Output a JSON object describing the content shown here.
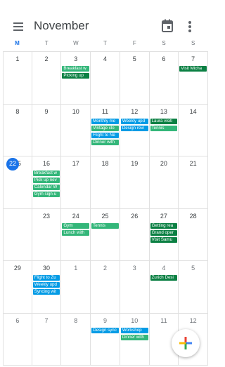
{
  "header": {
    "title": "November",
    "menu_icon": "hamburger-menu-icon",
    "today_icon": "calendar-today-icon",
    "more_icon": "more-vert-icon"
  },
  "weekdays": [
    "M",
    "T",
    "W",
    "T",
    "F",
    "S",
    "S"
  ],
  "weeks": [
    [
      {
        "day": "1",
        "muted": false,
        "events": []
      },
      {
        "day": "2",
        "muted": false,
        "events": []
      },
      {
        "day": "3",
        "muted": false,
        "events": [
          {
            "title": "Breakfast w",
            "color": "#33b679"
          },
          {
            "title": "Picking up",
            "color": "#0b8043"
          }
        ]
      },
      {
        "day": "4",
        "muted": false,
        "events": []
      },
      {
        "day": "5",
        "muted": false,
        "events": []
      },
      {
        "day": "6",
        "muted": false,
        "events": []
      },
      {
        "day": "7",
        "muted": false,
        "events": [
          {
            "title": "Visit Micha",
            "color": "#0b8043"
          }
        ]
      }
    ],
    [
      {
        "day": "8",
        "muted": false,
        "events": []
      },
      {
        "day": "9",
        "muted": false,
        "events": []
      },
      {
        "day": "10",
        "muted": false,
        "events": []
      },
      {
        "day": "11",
        "muted": false,
        "events": [
          {
            "title": "Monthly me",
            "color": "#039be5"
          },
          {
            "title": "Vintage clo",
            "color": "#33b679"
          },
          {
            "title": "Flight to Ne",
            "color": "#039be5"
          },
          {
            "title": "Dinner with",
            "color": "#33b679"
          }
        ]
      },
      {
        "day": "12",
        "muted": false,
        "events": [
          {
            "title": "Weekly upd",
            "color": "#039be5"
          },
          {
            "title": "Design revi",
            "color": "#039be5"
          }
        ]
      },
      {
        "day": "13",
        "muted": false,
        "events": [
          {
            "title": "Laura visiti",
            "color": "#0b8043"
          },
          {
            "title": "Tennis",
            "color": "#33b679"
          }
        ]
      },
      {
        "day": "14",
        "muted": false,
        "events": []
      }
    ],
    [
      {
        "day": "15",
        "muted": false,
        "events": []
      },
      {
        "day": "16",
        "muted": false,
        "events": [
          {
            "title": "Breakfast w",
            "color": "#33b679"
          },
          {
            "title": "Pick up nev",
            "color": "#33b679"
          },
          {
            "title": "Calendar W",
            "color": "#33b679"
          },
          {
            "title": "Gym sign-u",
            "color": "#33b679"
          }
        ]
      },
      {
        "day": "17",
        "muted": false,
        "events": []
      },
      {
        "day": "18",
        "muted": false,
        "events": []
      },
      {
        "day": "19",
        "muted": false,
        "events": []
      },
      {
        "day": "20",
        "muted": false,
        "events": []
      },
      {
        "day": "21",
        "muted": false,
        "events": []
      }
    ],
    [
      {
        "day": "22",
        "muted": false,
        "today": true,
        "events": []
      },
      {
        "day": "23",
        "muted": false,
        "events": []
      },
      {
        "day": "24",
        "muted": false,
        "events": [
          {
            "title": "Gym",
            "color": "#33b679"
          },
          {
            "title": "Lunch with",
            "color": "#33b679"
          }
        ]
      },
      {
        "day": "25",
        "muted": false,
        "events": [
          {
            "title": "Tennis",
            "color": "#33b679"
          }
        ]
      },
      {
        "day": "26",
        "muted": false,
        "events": []
      },
      {
        "day": "27",
        "muted": false,
        "events": [
          {
            "title": "Getting rea",
            "color": "#0b8043"
          },
          {
            "title": "Grand oper",
            "color": "#0b8043"
          },
          {
            "title": "Visit Samu",
            "color": "#0b8043"
          }
        ]
      },
      {
        "day": "28",
        "muted": false,
        "events": []
      }
    ],
    [
      {
        "day": "29",
        "muted": false,
        "events": []
      },
      {
        "day": "30",
        "muted": false,
        "events": [
          {
            "title": "Flight to Zu",
            "color": "#039be5"
          },
          {
            "title": "Weekly upd",
            "color": "#039be5"
          },
          {
            "title": "Syncing wit",
            "color": "#039be5"
          }
        ]
      },
      {
        "day": "1",
        "muted": true,
        "events": []
      },
      {
        "day": "2",
        "muted": true,
        "events": []
      },
      {
        "day": "3",
        "muted": true,
        "events": []
      },
      {
        "day": "4",
        "muted": true,
        "events": [
          {
            "title": "Zurich Desi",
            "color": "#0b8043"
          }
        ]
      },
      {
        "day": "5",
        "muted": true,
        "events": []
      }
    ],
    [
      {
        "day": "6",
        "muted": true,
        "events": []
      },
      {
        "day": "7",
        "muted": true,
        "events": []
      },
      {
        "day": "8",
        "muted": true,
        "events": []
      },
      {
        "day": "9",
        "muted": true,
        "events": [
          {
            "title": "Design sync",
            "color": "#039be5"
          }
        ]
      },
      {
        "day": "10",
        "muted": true,
        "events": [
          {
            "title": "Workshop",
            "color": "#039be5"
          },
          {
            "title": "Dinner with",
            "color": "#33b679"
          }
        ]
      },
      {
        "day": "11",
        "muted": true,
        "events": []
      },
      {
        "day": "12",
        "muted": true,
        "events": []
      }
    ]
  ],
  "fab": {
    "icon": "add-plus-icon"
  },
  "colors": {
    "accent": "#1a73e8",
    "event_blue": "#039be5",
    "event_green": "#33b679",
    "event_dark_green": "#0b8043"
  }
}
